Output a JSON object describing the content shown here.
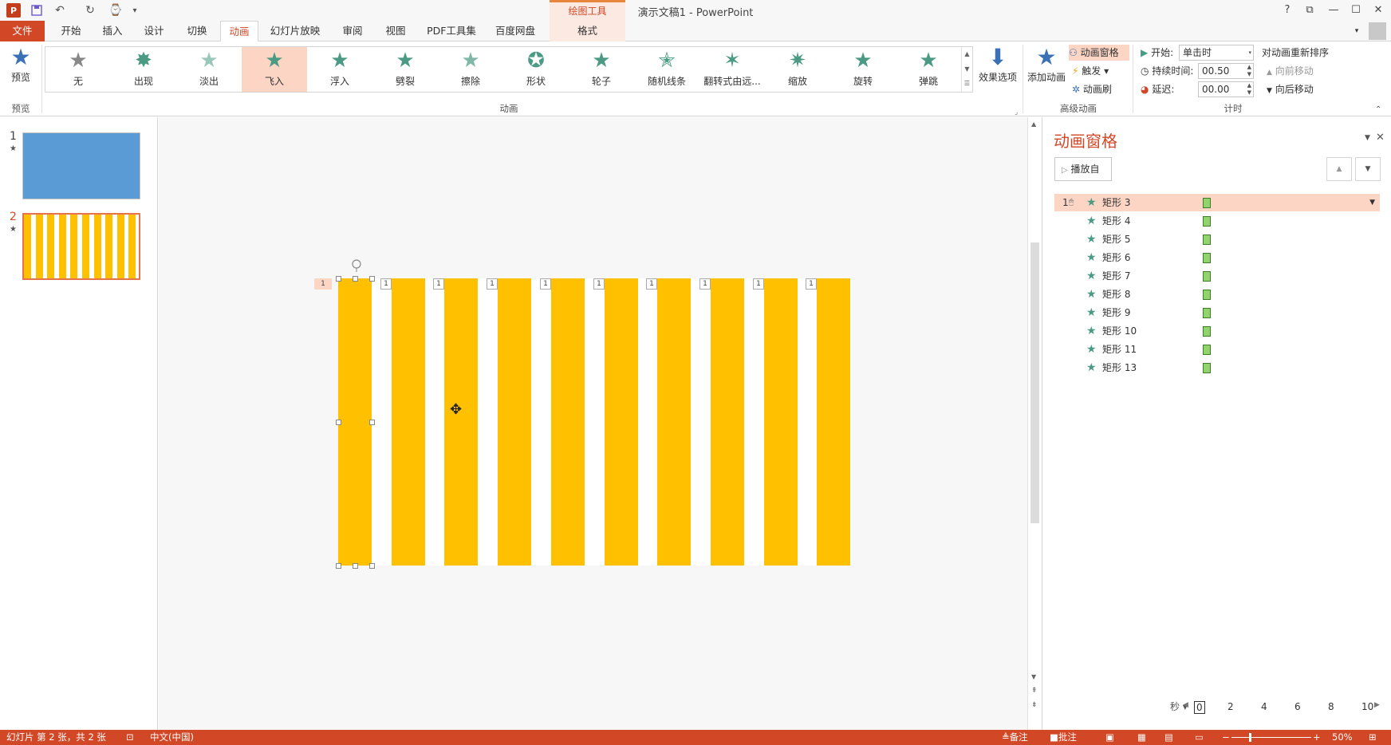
{
  "window": {
    "title": "演示文稿1 - PowerPoint",
    "context_tab_header": "绘图工具",
    "help": "?",
    "restore": "⧉",
    "minimize": "—",
    "maximize": "☐",
    "close": "✕"
  },
  "quick_access": {
    "logo": "P",
    "save": "💾",
    "undo": "↶",
    "redo": "↻",
    "presenter": "⌚",
    "customize": "▾"
  },
  "tabs": [
    {
      "label": "文件"
    },
    {
      "label": "开始"
    },
    {
      "label": "插入"
    },
    {
      "label": "设计"
    },
    {
      "label": "切换"
    },
    {
      "label": "动画"
    },
    {
      "label": "幻灯片放映"
    },
    {
      "label": "审阅"
    },
    {
      "label": "视图"
    },
    {
      "label": "PDF工具集"
    },
    {
      "label": "百度网盘"
    },
    {
      "label": "格式"
    }
  ],
  "ribbon": {
    "preview_label": "预览",
    "preview_group": "预览",
    "animation_group": "动画",
    "effects": [
      {
        "label": "无"
      },
      {
        "label": "出现"
      },
      {
        "label": "淡出"
      },
      {
        "label": "飞入"
      },
      {
        "label": "浮入"
      },
      {
        "label": "劈裂"
      },
      {
        "label": "擦除"
      },
      {
        "label": "形状"
      },
      {
        "label": "轮子"
      },
      {
        "label": "随机线条"
      },
      {
        "label": "翻转式由远..."
      },
      {
        "label": "缩放"
      },
      {
        "label": "旋转"
      },
      {
        "label": "弹跳"
      }
    ],
    "effect_options": "效果选项",
    "add_animation": "添加动画",
    "animation_pane": "动画窗格",
    "trigger": "触发",
    "painter": "动画刷",
    "advanced_group": "高级动画",
    "start_label": "开始:",
    "start_value": "单击时",
    "duration_label": "持续时间:",
    "duration_value": "00.50",
    "delay_label": "延迟:",
    "delay_value": "00.00",
    "reorder_label": "对动画重新排序",
    "move_earlier": "向前移动",
    "move_later": "向后移动",
    "timing_group": "计时"
  },
  "slides": [
    {
      "number": "1",
      "star": "★"
    },
    {
      "number": "2",
      "star": "★"
    }
  ],
  "canvas": {
    "bar_color": "#ffc000",
    "bar_count": 10,
    "tags": [
      "1",
      "1",
      "1",
      "1",
      "1",
      "1",
      "1",
      "1",
      "1",
      "1"
    ]
  },
  "anim_pane": {
    "title": "动画窗格",
    "play_from": "播放自",
    "items": [
      {
        "num": "1",
        "name": "矩形 3"
      },
      {
        "num": "",
        "name": "矩形 4"
      },
      {
        "num": "",
        "name": "矩形 5"
      },
      {
        "num": "",
        "name": "矩形 6"
      },
      {
        "num": "",
        "name": "矩形 7"
      },
      {
        "num": "",
        "name": "矩形 8"
      },
      {
        "num": "",
        "name": "矩形 9"
      },
      {
        "num": "",
        "name": "矩形 10"
      },
      {
        "num": "",
        "name": "矩形 11"
      },
      {
        "num": "",
        "name": "矩形 13"
      }
    ],
    "seconds_label": "秒",
    "ruler": [
      "0",
      "2",
      "4",
      "6",
      "8",
      "10"
    ]
  },
  "status": {
    "slide_info": "幻灯片 第 2 张，共 2 张",
    "language": "中文(中国)",
    "notes": "备注",
    "comments": "批注",
    "zoom": "50%"
  },
  "colors": {
    "accent": "#d24726",
    "selection": "#fcd5c5",
    "slide1_bg": "#5b9bd5",
    "effect_star": "#4a9a84"
  }
}
